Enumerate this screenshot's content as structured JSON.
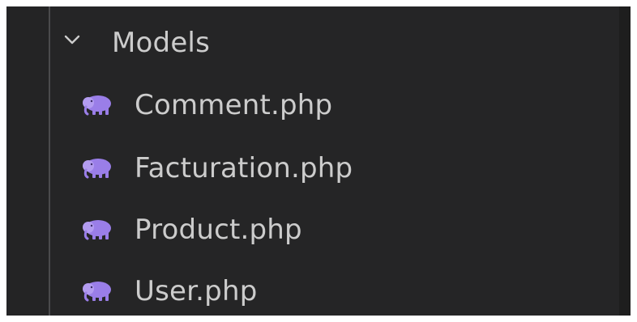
{
  "explorer": {
    "folder": {
      "label": "Models",
      "state": "expanded",
      "icon": "chevron-down-icon"
    },
    "files": [
      {
        "name": "Comment.php",
        "icon": "php-elephant-icon"
      },
      {
        "name": "Facturation.php",
        "icon": "php-elephant-icon"
      },
      {
        "name": "Product.php",
        "icon": "php-elephant-icon"
      },
      {
        "name": "User.php",
        "icon": "php-elephant-icon"
      }
    ]
  },
  "colors": {
    "panel_background": "#252526",
    "text": "#cccccc",
    "indent_guide": "#4a4a4c",
    "php_icon": "#9a7ee8"
  }
}
